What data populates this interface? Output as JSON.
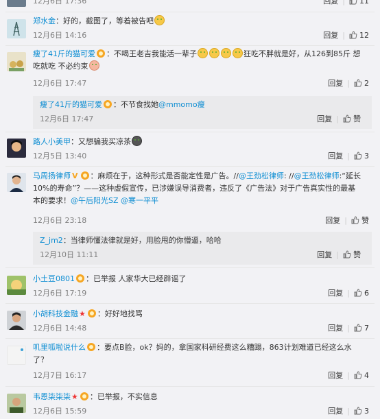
{
  "ui": {
    "reply_label": "回复",
    "like_label": "赞"
  },
  "top_partial": {
    "time": "12月6日 17:36",
    "likes": "11"
  },
  "comments": [
    {
      "user": "郑水金",
      "text": "：好的，截图了，等着被告吧",
      "time": "12月6日 14:16",
      "likes": "12"
    },
    {
      "user": "瘦了41斤的猫可爱",
      "text_a": "：不喝王老吉我能活一辈子",
      "text_b": "狂吃不胖就是好，从126到85斤 想",
      "text_c": "吃就吃 不必约束",
      "time": "12月6日 17:47",
      "likes": "2",
      "reply": {
        "user": "瘦了41斤的猫可爱",
        "text": "：不节食找她",
        "mention": "@mmomo瘦",
        "time": "12月6日 17:47"
      }
    },
    {
      "user": "路人小美甲",
      "text": "：又想骗我买凉茶",
      "time": "12月5日 13:40",
      "likes": "3"
    },
    {
      "user": "马周扬律师",
      "text_a": "：麻烦在于，这种形式是否能定性是广告。//",
      "mention_a": "@王劲松律师",
      "text_a2": ": //",
      "mention_b": "@王劲松律师",
      "text_a3": ":“延长",
      "text_b": "10%的寿命”？——这种虚假宣传，已涉嫌误导消费者，违反了《广告法》对于广告真实性的最基",
      "text_c": "本的要求！",
      "mention_c": "@午后阳光SZ",
      "mention_d": "@寒一平平",
      "time": "12月6日 23:18",
      "likes": "",
      "reply": {
        "user": "Z_jm2",
        "text": "：当律师懂法律就是好，用脸甩的你懵逼，哈哈",
        "time": "12月10日 11:11"
      }
    },
    {
      "user": "小土豆0801",
      "text": "：已举报 人家华大已经辟谣了",
      "time": "12月6日 17:19",
      "likes": "6"
    },
    {
      "user": "小胡科技金融",
      "text": "：好好地找骂",
      "time": "12月6日 14:48",
      "likes": "7"
    },
    {
      "user": "叽里呱啦说什么",
      "text_a": "：要点B脸，ok？妈的，拿国家科研经费这么糟蹋，863计划难道已经这么水",
      "text_b": "了？",
      "time": "12月7日 16:17",
      "likes": "4"
    },
    {
      "user": "韦恩柒柒柒",
      "text": "：已举报，不实信息",
      "time": "12月6日 15:59",
      "likes": "3"
    }
  ]
}
